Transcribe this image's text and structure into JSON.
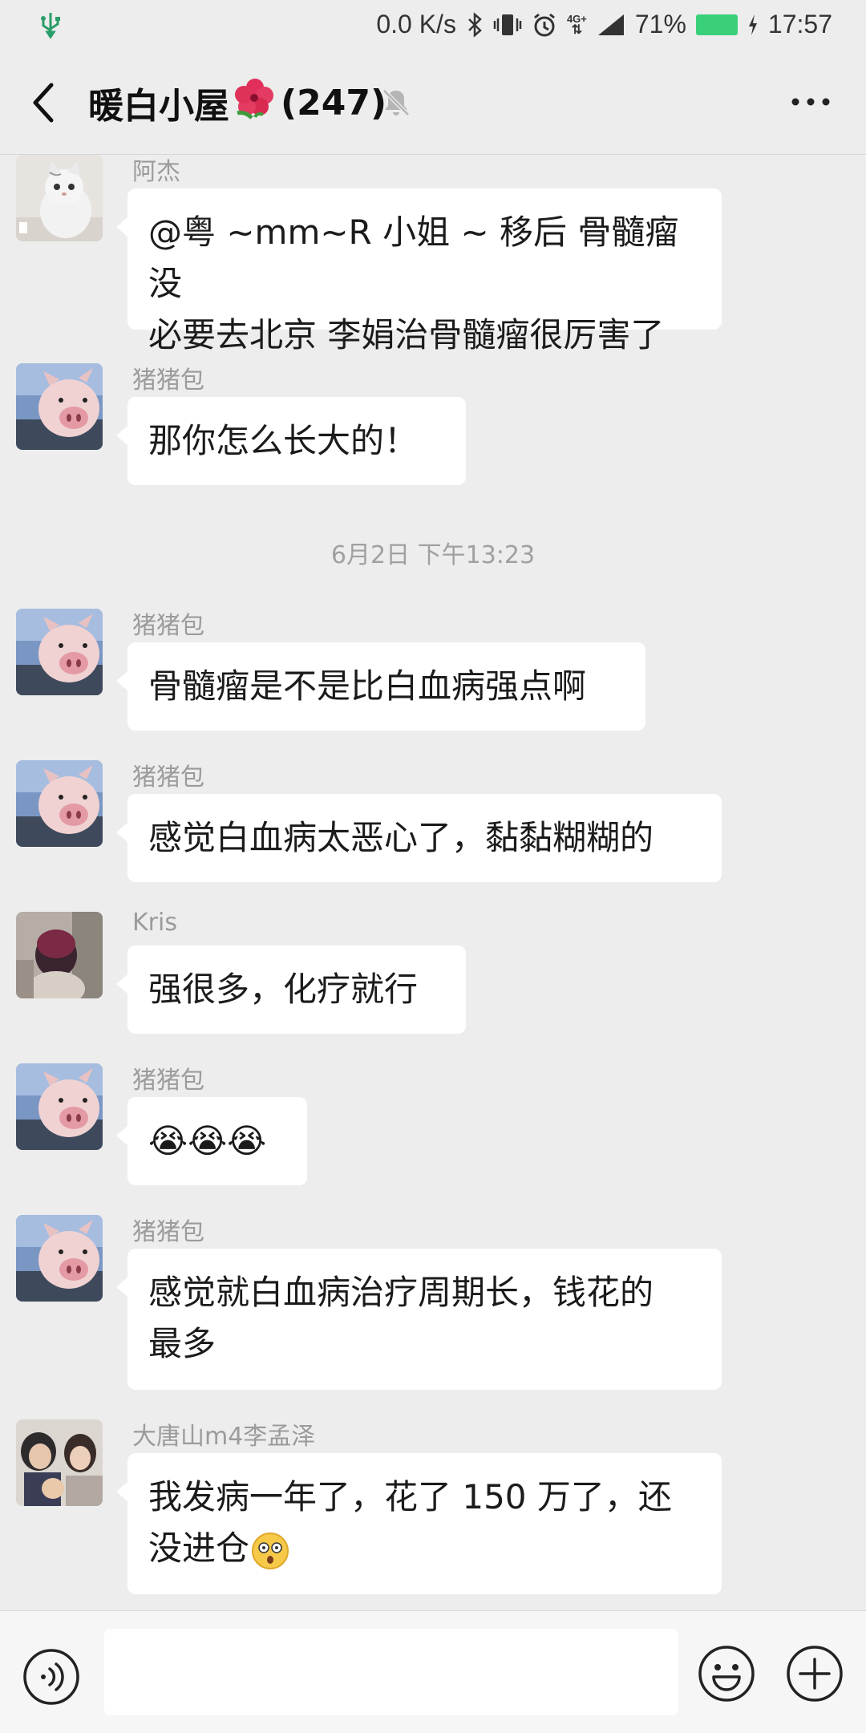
{
  "status_bar": {
    "network_speed": "0.0 K/s",
    "network_type": "4G+",
    "battery": "71%",
    "time": "17:57"
  },
  "header": {
    "title": "暖白小屋",
    "member_count": "(247)"
  },
  "messages": [
    {
      "sender": "阿杰",
      "text_line1": "@粤 ~mm~R 小姐 ~ 移后  骨髓瘤没",
      "text_line2": "必要去北京 李娟治骨髓瘤很厉害了"
    },
    {
      "sender": "猪猪包",
      "text": "那你怎么长大的！"
    },
    {
      "sender": "猪猪包",
      "text": "骨髓瘤是不是比白血病强点啊"
    },
    {
      "sender": "猪猪包",
      "text": "感觉白血病太恶心了，黏黏糊糊的"
    },
    {
      "sender": "Kris",
      "text": "强很多，化疗就行"
    },
    {
      "sender": "猪猪包",
      "text": "😭😭😭"
    },
    {
      "sender": "猪猪包",
      "text_line1": "感觉就白血病治疗周期长，钱花的",
      "text_line2": "最多"
    },
    {
      "sender": "大唐山m4李孟泽",
      "text_line1": "我发病一年了，花了 150 万了，还",
      "text_line2": "没进仓"
    }
  ],
  "timestamp": "6月2日 下午13:23",
  "input": {
    "placeholder": ""
  },
  "colors": {
    "background": "#ededed",
    "bubble": "#ffffff",
    "sender": "#9b9b9b",
    "battery": "#3ad07a"
  },
  "icons": [
    "usb-icon",
    "bluetooth-icon",
    "vibrate-icon",
    "alarm-icon",
    "signal-icon",
    "charging-icon",
    "back-icon",
    "hibiscus-icon",
    "mute-bell-icon",
    "more-icon",
    "voice-icon",
    "emoji-icon",
    "plus-icon",
    "cat-avatar",
    "pig-avatar",
    "girl-avatar",
    "family-avatar",
    "dizzy-face-icon"
  ]
}
